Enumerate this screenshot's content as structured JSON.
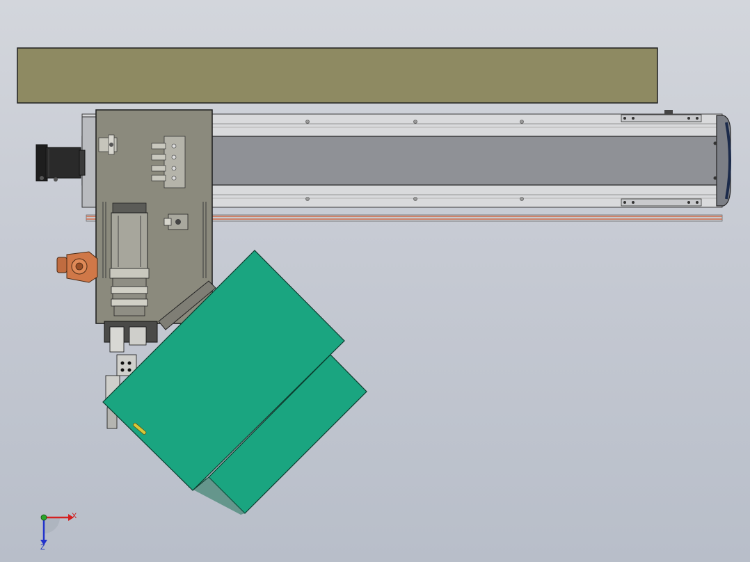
{
  "triad": {
    "x_label": "X",
    "z_label": "Z",
    "x_color": "#d42020",
    "y_color": "#2aa52a",
    "z_color": "#2233cc"
  },
  "colors": {
    "background_top": "#d3d6dc",
    "background_bottom": "#b8bec9",
    "overhead_beam": "#8e8a62",
    "linear_module_body": "#8f9196",
    "carriage_plate": "#8b8a7d",
    "sheets": "#1aa580",
    "motor": "#2a2a2a",
    "coupling": "#d07848",
    "accent_stripe": "#d06a4a"
  }
}
